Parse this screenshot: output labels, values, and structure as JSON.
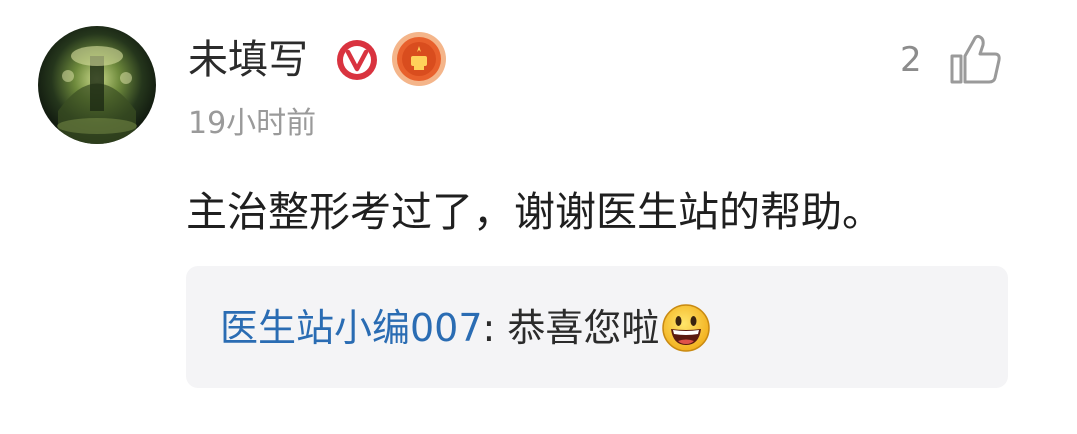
{
  "comment": {
    "username": "未填写",
    "badges": {
      "vip": {
        "icon": "vip-v-icon",
        "letter": "V",
        "color": "#d9333f"
      },
      "medal": {
        "icon": "medal-icon",
        "color": "#e8602c"
      }
    },
    "timestamp": "19小时前",
    "likes": {
      "count": "2",
      "icon": "thumbs-up-icon"
    },
    "text": "主治整形考过了，谢谢医生站的帮助。",
    "reply": {
      "author": "医生站小编007",
      "separator": ": ",
      "text": "恭喜您啦",
      "emoji": "grinning-face-icon"
    }
  },
  "colors": {
    "username": "#2b2b2b",
    "timestamp": "#9a9a9a",
    "reply_author": "#2a6cb3",
    "reply_background": "#f4f4f6"
  }
}
